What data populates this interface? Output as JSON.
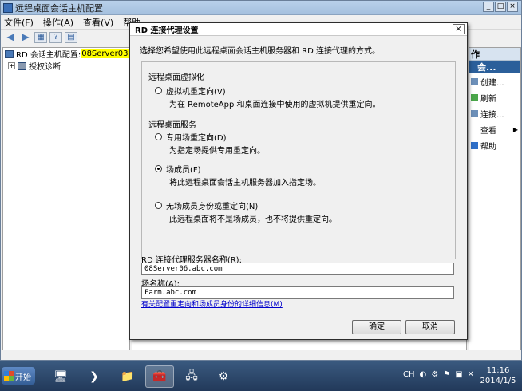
{
  "window": {
    "title": "远程桌面会话主机配置",
    "controls": [
      "_",
      "□",
      "×"
    ]
  },
  "menubar": {
    "items": [
      "文件(F)",
      "操作(A)",
      "查看(V)",
      "帮助"
    ]
  },
  "tree": {
    "root_label": "RD 会话主机配置:",
    "root_server": "08Server03",
    "child_label": "授权诊断"
  },
  "actions": {
    "header": "作",
    "subheader": "会...",
    "items": [
      {
        "label": "创建..."
      },
      {
        "label": "刷新"
      },
      {
        "label": "连接..."
      },
      {
        "label": "查看",
        "arrow": "▶"
      },
      {
        "label": "帮助"
      }
    ]
  },
  "dialog": {
    "title": "RD 连接代理设置",
    "close": "×",
    "intro": "选择您希望使用此远程桌面会话主机服务器和 RD 连接代理的方式。",
    "section_virtualization": "远程桌面虚拟化",
    "opt_vm_redirect": "虚拟机重定向(V)",
    "opt_vm_redirect_desc": "为在 RemoteApp 和桌面连接中使用的虚拟机提供重定向。",
    "section_rds": "远程桌面服务",
    "opt_dedicated": "专用场重定向(D)",
    "opt_dedicated_desc": "为指定场提供专用重定向。",
    "opt_member": "场成员(F)",
    "opt_member_desc": "将此远程桌面会话主机服务器加入指定场。",
    "opt_none": "无场成员身份或重定向(N)",
    "opt_none_desc": "此远程桌面将不是场成员，也不将提供重定向。",
    "selected_option": "member",
    "server_label": "RD 连接代理服务器名称(R):",
    "server_value": "08Server06.abc.com",
    "farm_label": "场名称(A):",
    "farm_value": "Farm.abc.com",
    "link": "有关配置重定向和场成员身份的详细信息(M)",
    "ok": "确定",
    "cancel": "取消"
  },
  "taskbar": {
    "start": "开始",
    "tray_lang": "CH",
    "time": "11:16",
    "date": "2014/1/5"
  }
}
